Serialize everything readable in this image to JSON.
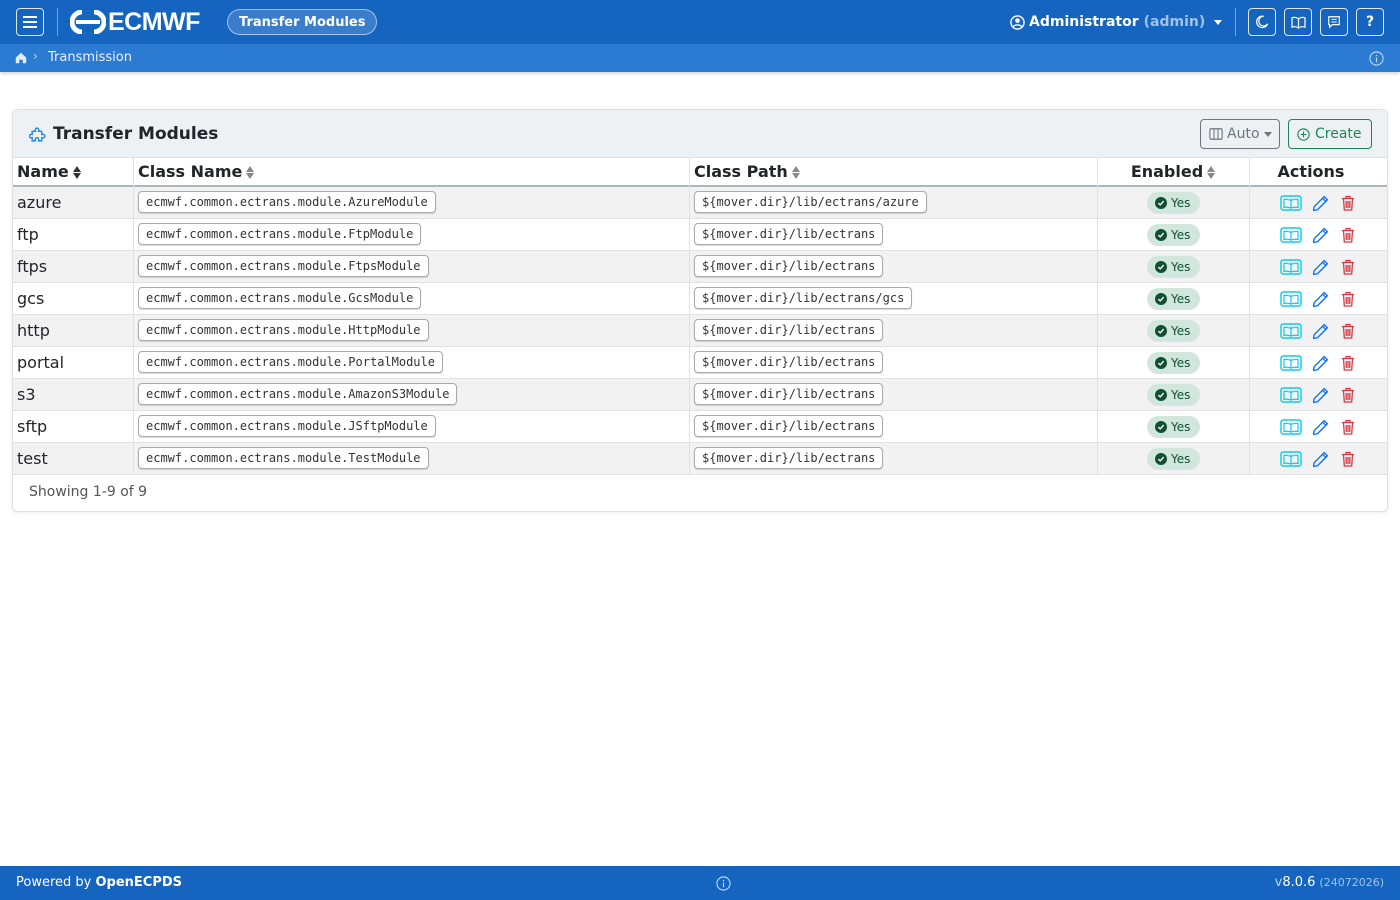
{
  "navbar": {
    "menu_icon": "hamburger-icon",
    "brand": "ECMWF",
    "app_pill": "Transfer Modules",
    "user_role": "Administrator",
    "user_id": "(admin)",
    "theme_icon": "moon-icon",
    "docs_icon": "book-icon",
    "messages_icon": "chat-icon",
    "help_label": "?"
  },
  "breadcrumb": {
    "home_icon": "home-icon",
    "separator": "›",
    "current": "Transmission"
  },
  "card": {
    "title": "Transfer Modules",
    "auto_label": "Auto",
    "create_label": "Create"
  },
  "table": {
    "headers": {
      "name": "Name",
      "class_name": "Class Name",
      "class_path": "Class Path",
      "enabled": "Enabled",
      "actions": "Actions"
    },
    "rows": [
      {
        "name": "azure",
        "class_name": "ecmwf.common.ectrans.module.AzureModule",
        "class_path": "${mover.dir}/lib/ectrans/azure",
        "enabled": "Yes"
      },
      {
        "name": "ftp",
        "class_name": "ecmwf.common.ectrans.module.FtpModule",
        "class_path": "${mover.dir}/lib/ectrans",
        "enabled": "Yes"
      },
      {
        "name": "ftps",
        "class_name": "ecmwf.common.ectrans.module.FtpsModule",
        "class_path": "${mover.dir}/lib/ectrans",
        "enabled": "Yes"
      },
      {
        "name": "gcs",
        "class_name": "ecmwf.common.ectrans.module.GcsModule",
        "class_path": "${mover.dir}/lib/ectrans/gcs",
        "enabled": "Yes"
      },
      {
        "name": "http",
        "class_name": "ecmwf.common.ectrans.module.HttpModule",
        "class_path": "${mover.dir}/lib/ectrans",
        "enabled": "Yes"
      },
      {
        "name": "portal",
        "class_name": "ecmwf.common.ectrans.module.PortalModule",
        "class_path": "${mover.dir}/lib/ectrans",
        "enabled": "Yes"
      },
      {
        "name": "s3",
        "class_name": "ecmwf.common.ectrans.module.AmazonS3Module",
        "class_path": "${mover.dir}/lib/ectrans",
        "enabled": "Yes"
      },
      {
        "name": "sftp",
        "class_name": "ecmwf.common.ectrans.module.JSftpModule",
        "class_path": "${mover.dir}/lib/ectrans",
        "enabled": "Yes"
      },
      {
        "name": "test",
        "class_name": "ecmwf.common.ectrans.module.TestModule",
        "class_path": "${mover.dir}/lib/ectrans",
        "enabled": "Yes"
      }
    ],
    "row_actions": [
      "view-icon",
      "edit-pencil-icon",
      "delete-trash-icon"
    ],
    "showing": "Showing 1-9 of 9"
  },
  "footer": {
    "powered_prefix": "Powered by",
    "powered_name": "OpenECPDS",
    "version_prefix": "v",
    "version": "8.0.6",
    "build": "(24072026)"
  },
  "colors": {
    "navbar": "#1565c0",
    "breadcrumb_bar": "#2b7bd3",
    "create_green": "#198754",
    "delete_red": "#dc3545",
    "view_teal": "#0dcaf0",
    "edit_blue": "#0d6efd",
    "badge_bg": "#d1e7dd"
  }
}
